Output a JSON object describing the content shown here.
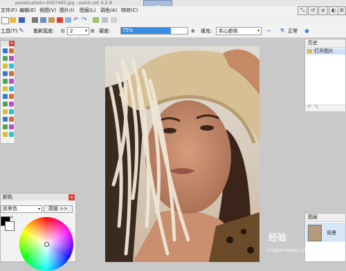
{
  "window": {
    "title": "pexels-photo-3597485.jpg - paint.net 4.2.8"
  },
  "menu": {
    "items": [
      "文件(F)",
      "编辑(E)",
      "视图(V)",
      "图片(I)",
      "图层(L)",
      "调色(A)",
      "特效(C)"
    ]
  },
  "toolbar2": {
    "tool_label": "工具(T):",
    "brush_width_label": "笔刷宽度:",
    "brush_width_value": "2",
    "hardness_label": "硬度:",
    "hardness_value": "75%",
    "hardness_percent": 75,
    "fill_label": "填充:",
    "fill_value": "实心颜色",
    "blend_value": "正常"
  },
  "history": {
    "title": "历史",
    "items": [
      "打开图片"
    ]
  },
  "layers": {
    "title": "图层",
    "items": [
      "背景"
    ]
  },
  "colors": {
    "title": "颜色",
    "selector_value": "前景色",
    "more_label": "高级 >>",
    "primary_color": "#000000",
    "secondary_color": "#ffffff"
  },
  "watermark": {
    "brand": "经验",
    "url": "jingyan.baidu.com"
  },
  "palette_colors": [
    "#2f7ad8",
    "#d86c2f",
    "#4aa84a",
    "#b94ad8",
    "#d8c02f",
    "#2fbfd8"
  ]
}
